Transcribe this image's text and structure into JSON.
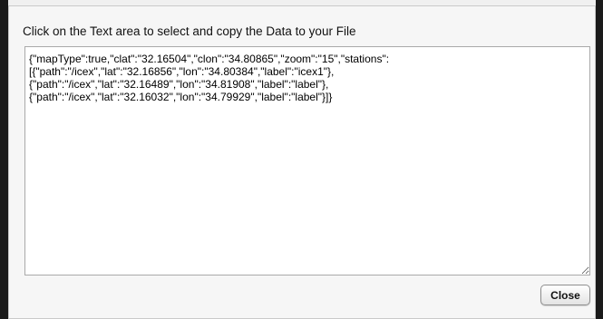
{
  "dialog": {
    "instruction": "Click on the Text area to select and copy the Data to your File",
    "data_text": "{\"mapType\":true,\"clat\":\"32.16504\",\"clon\":\"34.80865\",\"zoom\":\"15\",\"stations\":\n[{\"path\":\"/icex\",\"lat\":\"32.16856\",\"lon\":\"34.80384\",\"label\":\"icex1\"},\n{\"path\":\"/icex\",\"lat\":\"32.16489\",\"lon\":\"34.81908\",\"label\":\"label\"},\n{\"path\":\"/icex\",\"lat\":\"32.16032\",\"lon\":\"34.79929\",\"label\":\"label\"}]}",
    "close_label": "Close"
  }
}
